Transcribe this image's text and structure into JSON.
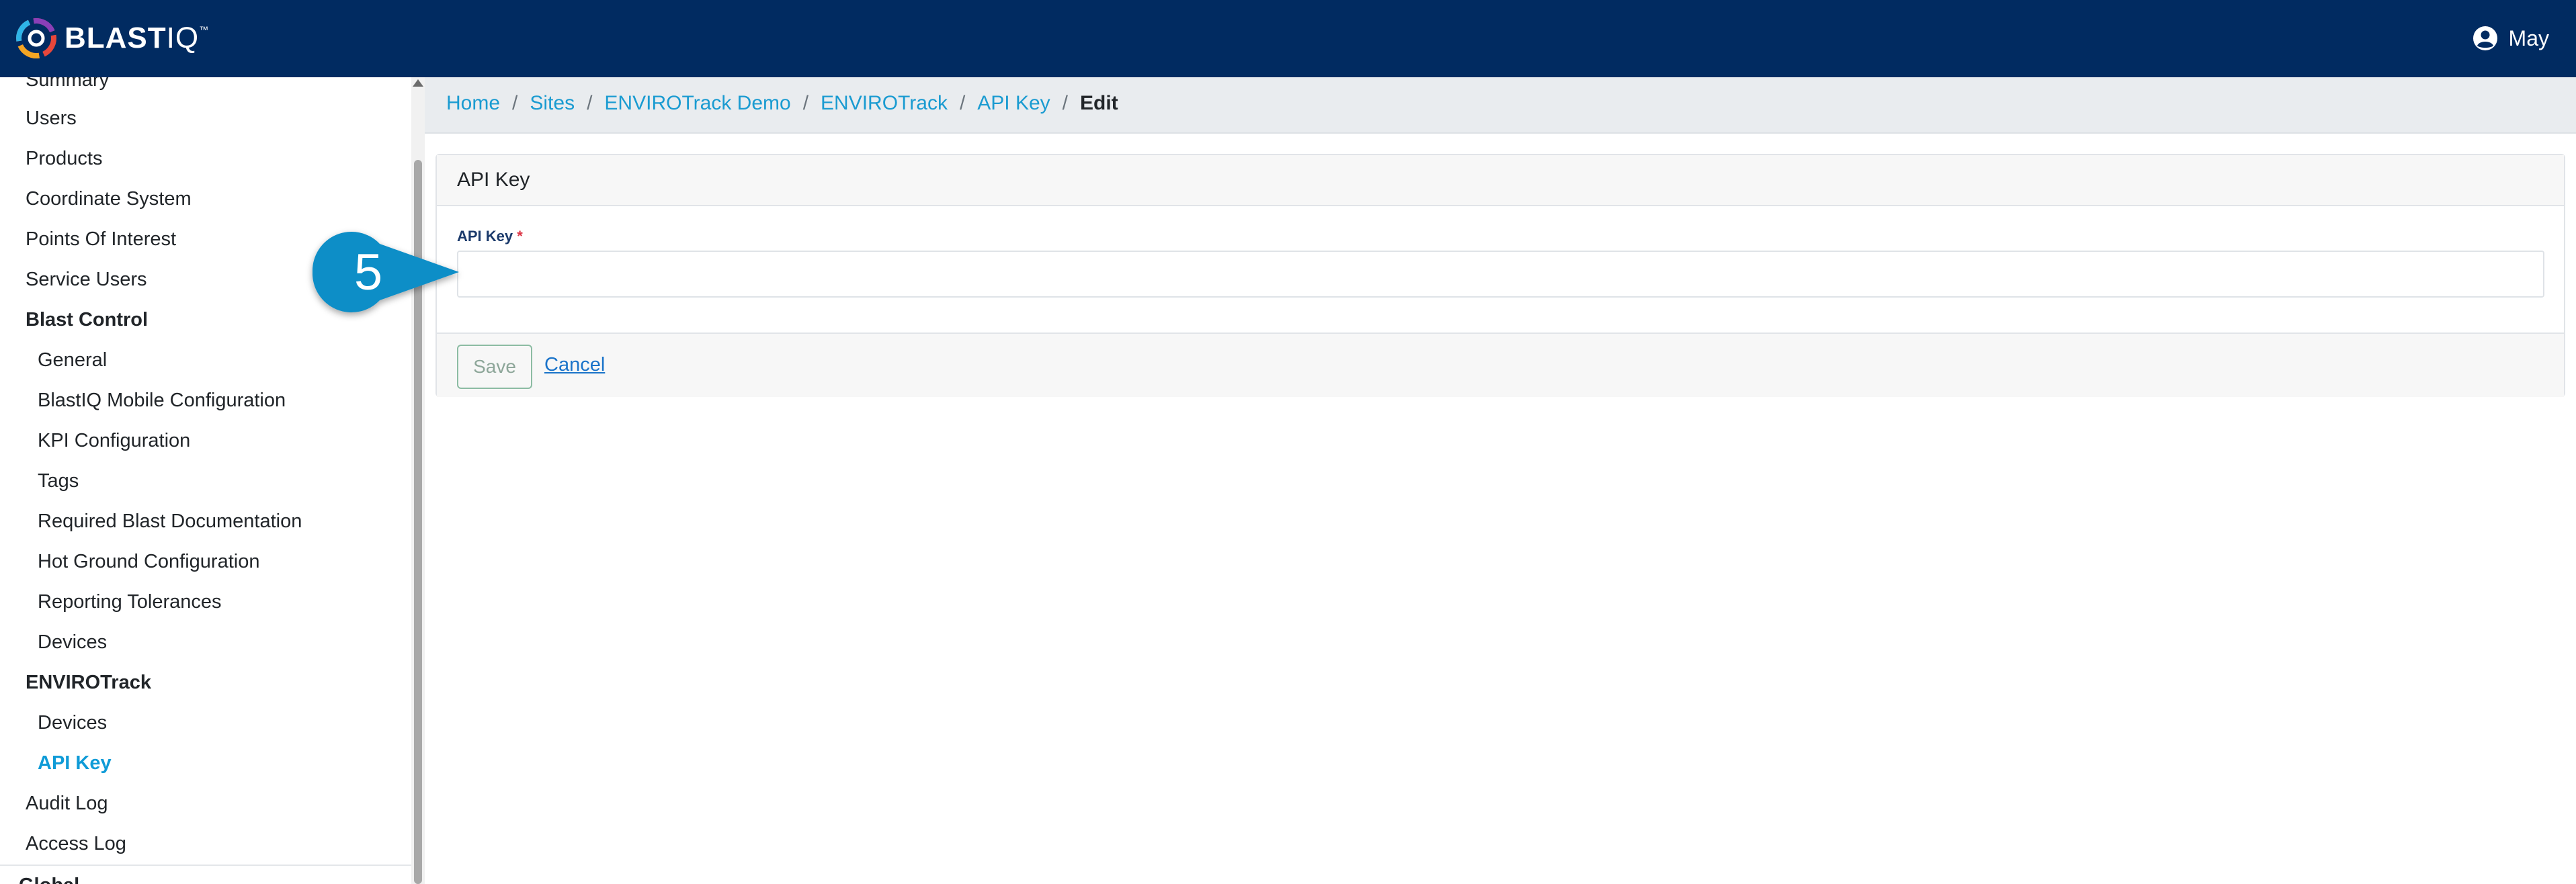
{
  "app": {
    "logo_main": "BLAST",
    "logo_iq": "IQ",
    "logo_tm": "™",
    "user_name": "May"
  },
  "colors": {
    "topbar": "#012b61",
    "accent": "#0f9bd7",
    "callout": "#0e8ec7",
    "required": "#dc3545"
  },
  "sidebar": {
    "items": [
      {
        "label": "Summary",
        "level": 1,
        "kind": "item"
      },
      {
        "label": "Users",
        "level": 1,
        "kind": "item"
      },
      {
        "label": "Products",
        "level": 1,
        "kind": "item"
      },
      {
        "label": "Coordinate System",
        "level": 1,
        "kind": "item"
      },
      {
        "label": "Points Of Interest",
        "level": 1,
        "kind": "item"
      },
      {
        "label": "Service Users",
        "level": 1,
        "kind": "item"
      },
      {
        "label": "Blast Control",
        "level": 1,
        "kind": "group"
      },
      {
        "label": "General",
        "level": 2,
        "kind": "item"
      },
      {
        "label": "BlastIQ Mobile Configuration",
        "level": 2,
        "kind": "item"
      },
      {
        "label": "KPI Configuration",
        "level": 2,
        "kind": "item"
      },
      {
        "label": "Tags",
        "level": 2,
        "kind": "item"
      },
      {
        "label": "Required Blast Documentation",
        "level": 2,
        "kind": "item"
      },
      {
        "label": "Hot Ground Configuration",
        "level": 2,
        "kind": "item"
      },
      {
        "label": "Reporting Tolerances",
        "level": 2,
        "kind": "item"
      },
      {
        "label": "Devices",
        "level": 2,
        "kind": "item"
      },
      {
        "label": "ENVIROTrack",
        "level": 1,
        "kind": "group"
      },
      {
        "label": "Devices",
        "level": 2,
        "kind": "item"
      },
      {
        "label": "API Key",
        "level": 2,
        "kind": "active"
      },
      {
        "label": "Audit Log",
        "level": 1,
        "kind": "item"
      },
      {
        "label": "Access Log",
        "level": 1,
        "kind": "item"
      },
      {
        "label": "Global",
        "level": 1,
        "kind": "group"
      }
    ]
  },
  "breadcrumb": {
    "items": [
      "Home",
      "Sites",
      "ENVIROTrack Demo",
      "ENVIROTrack",
      "API Key"
    ],
    "current": "Edit",
    "separator": "/"
  },
  "form": {
    "card_title": "API Key",
    "field_label": "API Key",
    "required_mark": "*",
    "field_value": "",
    "save_label": "Save",
    "cancel_label": "Cancel"
  },
  "callout": {
    "step": "5"
  },
  "icons": {
    "logo": "blastiq-logo-icon",
    "user": "user-circle-icon",
    "scroll_up": "triangle-up-icon"
  }
}
